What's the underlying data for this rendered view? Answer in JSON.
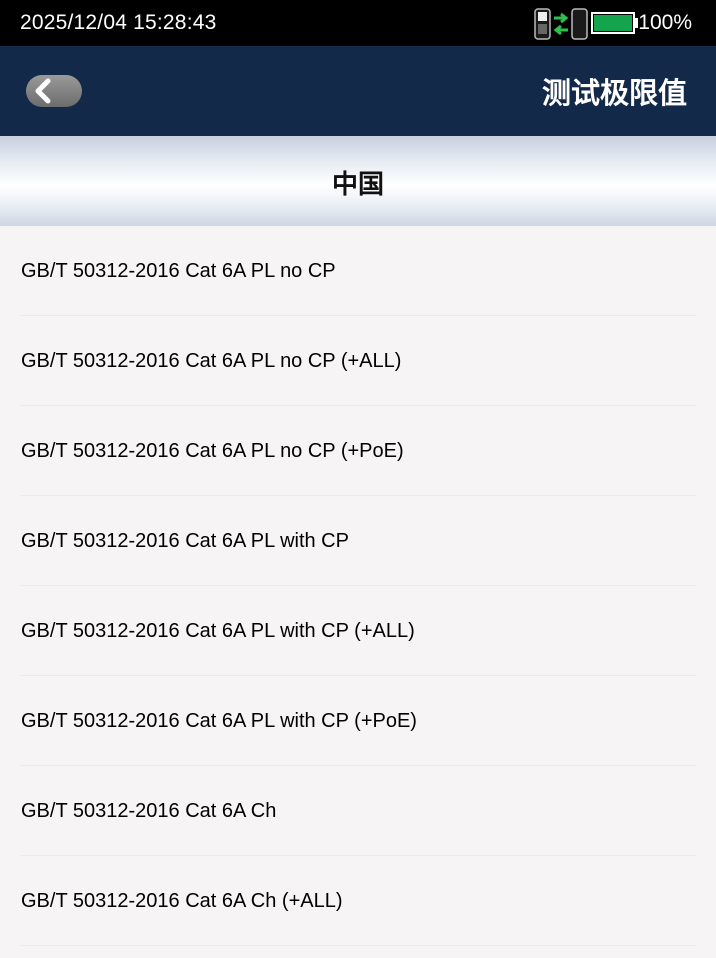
{
  "status": {
    "datetime": "2025/12/04 15:28:43",
    "battery_percent": "100%",
    "battery_level": 1.0,
    "battery_color": "#14a44d"
  },
  "header": {
    "title": "测试极限值",
    "back_icon": "chevron-left-icon"
  },
  "section": {
    "title": "中国"
  },
  "limits": {
    "items": [
      {
        "label": "GB/T 50312-2016 Cat 6A PL no CP"
      },
      {
        "label": "GB/T 50312-2016 Cat 6A PL no CP (+ALL)"
      },
      {
        "label": "GB/T 50312-2016 Cat 6A PL no CP (+PoE)"
      },
      {
        "label": "GB/T 50312-2016 Cat 6A PL with CP"
      },
      {
        "label": "GB/T 50312-2016 Cat 6A PL with CP (+ALL)"
      },
      {
        "label": "GB/T 50312-2016 Cat 6A PL with CP (+PoE)"
      },
      {
        "label": "GB/T 50312-2016 Cat 6A Ch"
      },
      {
        "label": "GB/T 50312-2016 Cat 6A Ch (+ALL)"
      }
    ]
  },
  "colors": {
    "title_bar": "#13294a",
    "status_bar": "#000000",
    "list_background": "#f6f4f5"
  }
}
